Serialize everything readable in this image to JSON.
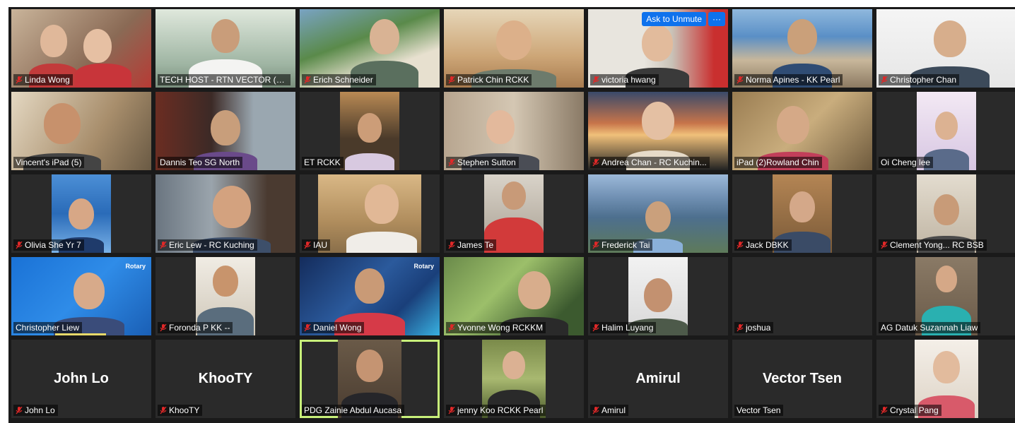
{
  "meeting": {
    "participants": [
      {
        "name": "Linda Wong",
        "muted": true
      },
      {
        "name": "TECH HOST - RTN VECTOR (R...",
        "muted": false
      },
      {
        "name": "Erich Schneider",
        "muted": true
      },
      {
        "name": "Patrick Chin RCKK",
        "muted": true
      },
      {
        "name": "victoria hwang",
        "muted": true
      },
      {
        "name": "Norma Apines - KK Pearl",
        "muted": true
      },
      {
        "name": "Christopher Chan",
        "muted": true
      },
      {
        "name": "Vincent's iPad (5)",
        "muted": false
      },
      {
        "name": "Dannis Teo SG North",
        "muted": false
      },
      {
        "name": "ET RCKK",
        "muted": false
      },
      {
        "name": "Stephen Sutton",
        "muted": true
      },
      {
        "name": "Andrea Chan - RC Kuchin...",
        "muted": true
      },
      {
        "name": "iPad (2)Rowland Chin",
        "muted": false
      },
      {
        "name": "Oi Cheng lee",
        "muted": false
      },
      {
        "name": "Olivia She Yr 7",
        "muted": true
      },
      {
        "name": "Eric Lew - RC Kuching",
        "muted": true
      },
      {
        "name": "IAU",
        "muted": true
      },
      {
        "name": "James Te",
        "muted": true
      },
      {
        "name": "Frederick Tai",
        "muted": true
      },
      {
        "name": "Jack DBKK",
        "muted": true
      },
      {
        "name": "Clement Yong... RC BSB",
        "muted": true
      },
      {
        "name": "Christopher Liew",
        "muted": false
      },
      {
        "name": "Foronda P   KK --",
        "muted": true
      },
      {
        "name": "Daniel Wong",
        "muted": true
      },
      {
        "name": "Yvonne Wong RCKKM",
        "muted": true
      },
      {
        "name": "Halim Luyang",
        "muted": true
      },
      {
        "name": "joshua",
        "muted": true
      },
      {
        "name": "AG Datuk Suzannah Liaw",
        "muted": false
      },
      {
        "name": "John Lo",
        "muted": true,
        "big_name": "John Lo"
      },
      {
        "name": "KhooTY",
        "muted": true,
        "big_name": "KhooTY"
      },
      {
        "name": "PDG Zainie Abdul Aucasa",
        "muted": false
      },
      {
        "name": "jenny Koo RCKK Pearl",
        "muted": true
      },
      {
        "name": "Amirul",
        "muted": true,
        "big_name": "Amirul"
      },
      {
        "name": "Vector Tsen",
        "muted": false,
        "big_name": "Vector Tsen"
      },
      {
        "name": "Crystal Pang",
        "muted": true
      }
    ],
    "ask_to_unmute_label": "Ask to Unmute",
    "more_label": "···",
    "rotary_label": "Rotary",
    "accent_color": "#0e72ed",
    "active_speaker_color": "#c8f07a",
    "muted_icon_color": "#e02828"
  }
}
